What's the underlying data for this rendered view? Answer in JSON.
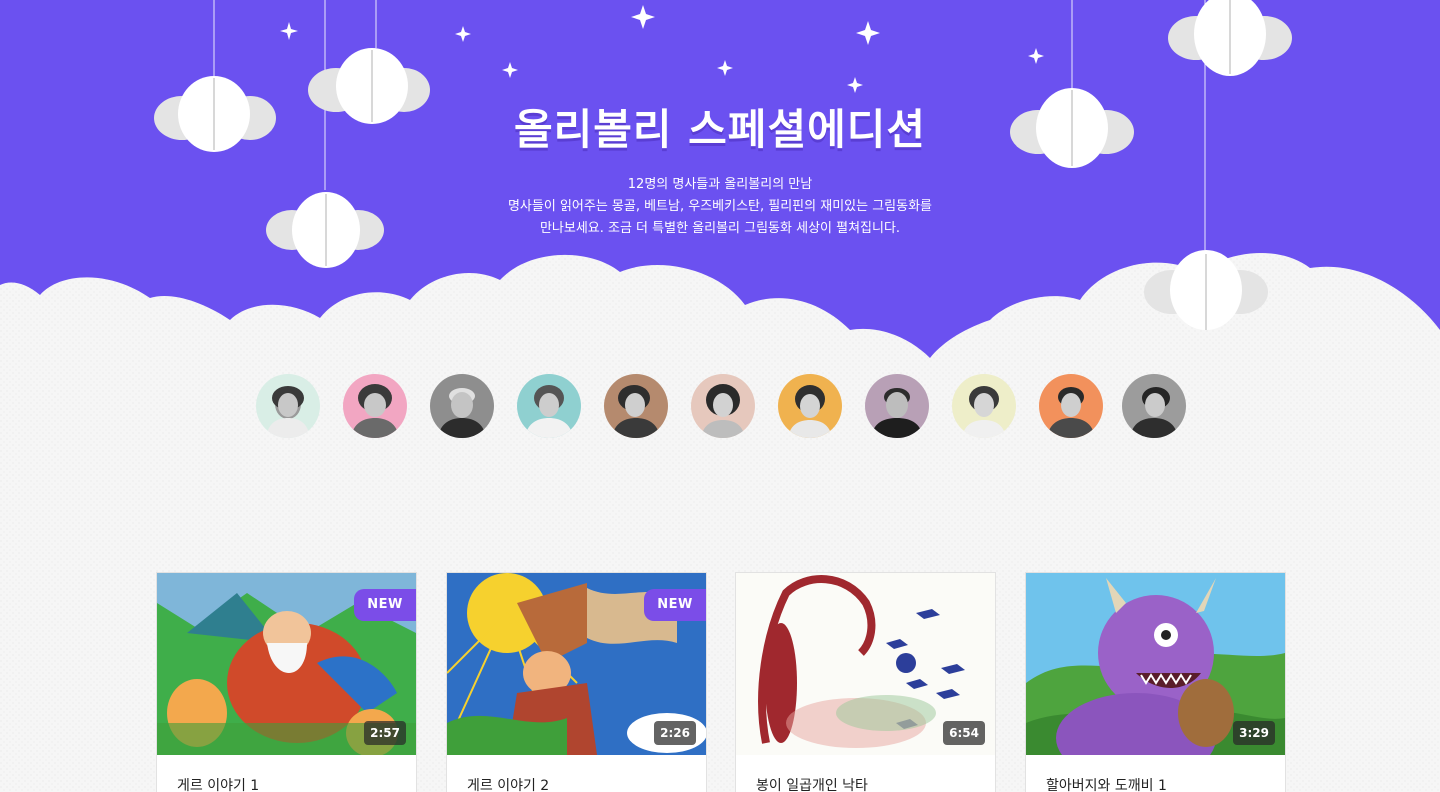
{
  "hero": {
    "title": "올리볼리 스페셜에디션",
    "desc_line1": "12명의 명사들과 올리볼리의 만남",
    "desc_line2": "명사들이 읽어주는 몽골, 베트남, 우즈베키스탄, 필리핀의 재미있는 그림동화를",
    "desc_line3": "만나보세요. 조금 더 특별한 올리볼리 그림동화 세상이 펼쳐집니다."
  },
  "colors": {
    "hero_purple": "#6b51f0",
    "cloud_white": "#f7f7f7",
    "badge_purple": "#7b4de8"
  },
  "celebrities": [
    {
      "name": "avatar-1",
      "bg": "#d9eee6"
    },
    {
      "name": "avatar-2",
      "bg": "#f2a6c2"
    },
    {
      "name": "avatar-3",
      "bg": "#8e8e8e"
    },
    {
      "name": "avatar-4",
      "bg": "#8fd0d0"
    },
    {
      "name": "avatar-5",
      "bg": "#b58a6e"
    },
    {
      "name": "avatar-6",
      "bg": "#e6c8bd"
    },
    {
      "name": "avatar-7",
      "bg": "#f0b24f"
    },
    {
      "name": "avatar-8",
      "bg": "#b8a0b6"
    },
    {
      "name": "avatar-9",
      "bg": "#eeeec9"
    },
    {
      "name": "avatar-10",
      "bg": "#f2915c"
    },
    {
      "name": "avatar-11",
      "bg": "#9c9c9c"
    }
  ],
  "videos": [
    {
      "title": "게르 이야기 1",
      "duration": "2:57",
      "badge": "NEW"
    },
    {
      "title": "게르 이야기 2",
      "duration": "2:26",
      "badge": "NEW"
    },
    {
      "title": "봉이 일곱개인 낙타",
      "duration": "6:54",
      "badge": ""
    },
    {
      "title": "할아버지와 도깨비 1",
      "duration": "3:29",
      "badge": ""
    }
  ]
}
